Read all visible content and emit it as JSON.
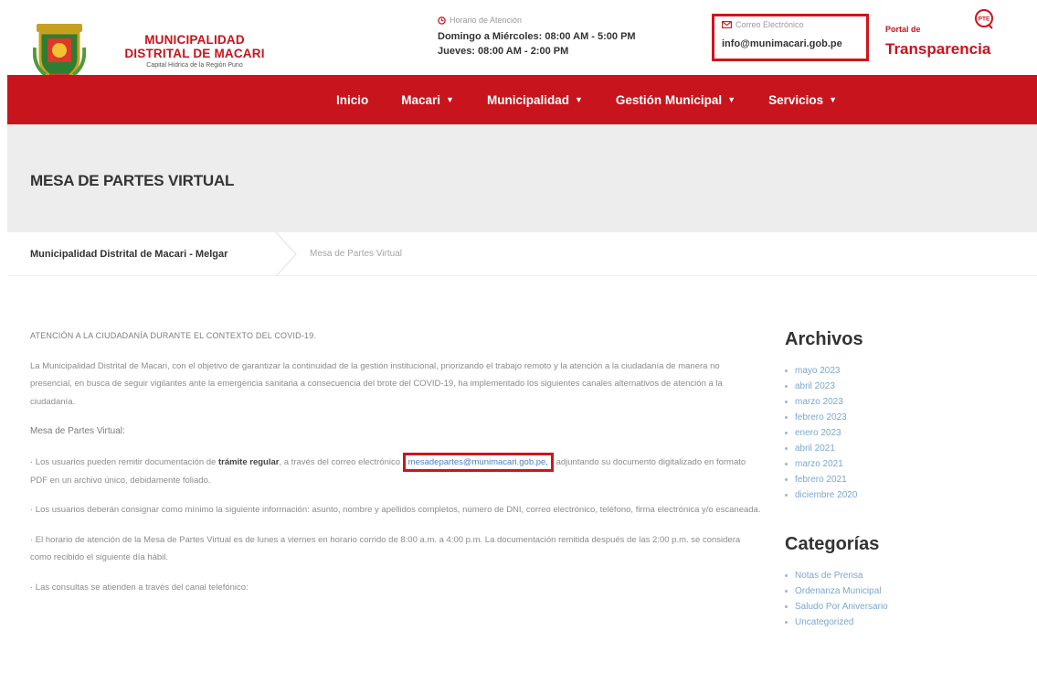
{
  "header": {
    "logo_title_line1": "MUNICIPALIDAD",
    "logo_title_line2": "DISTRITAL DE MACARI",
    "logo_subtitle": "Capital Hídrica de la Región Puno",
    "hours_label": "Horario de Atención",
    "hours_line1": "Domingo a Miércoles: 08:00 AM - 5:00 PM",
    "hours_line2": "Jueves: 08:00 AM - 2:00 PM",
    "email_label": "Correo Electrónico",
    "email_value": "info@munimacari.gob.pe",
    "portal_small": "Portal de",
    "portal_big": "Transparencia",
    "pte_badge": "PTE"
  },
  "nav": {
    "items": [
      {
        "label": "Inicio",
        "dropdown": false
      },
      {
        "label": "Macari",
        "dropdown": true
      },
      {
        "label": "Municipalidad",
        "dropdown": true
      },
      {
        "label": "Gestión Municipal",
        "dropdown": true
      },
      {
        "label": "Servicios",
        "dropdown": true
      }
    ]
  },
  "page": {
    "title": "MESA DE PARTES VIRTUAL",
    "breadcrumb_home": "Municipalidad Distrital de Macari - Melgar",
    "breadcrumb_current": "Mesa de Partes Virtual"
  },
  "content": {
    "headline": "ATENCIÓN A LA CIUDADANÍA DURANTE EL CONTEXTO DEL COVID-19.",
    "intro": "La Municipalidad Distrital de Macari, con el objetivo de garantizar la continuidad de la gestión institucional, priorizando el trabajo remoto y la atención a la ciudadanía de manera no presencial, en busca de seguir vigilantes ante la emergencia sanitaria a consecuencia del brote del COVID-19, ha implementado los siguientes canales alternativos de atención a la ciudadanía.",
    "section_title": "Mesa de Partes Virtual:",
    "p1_before": "· Los usuarios pueden remitir documentación de ",
    "p1_bold": "trámite regular",
    "p1_middle": ", a través del correo electrónico ",
    "p1_email": "mesadepartes@munimacari.gob.pe,",
    "p1_after": " adjuntando su documento digitalizado en formato PDF en un archivo único, debidamente foliado.",
    "p2": "· Los usuarios deberán consignar como mínimo la siguiente información: asunto, nombre y apellidos completos, número de DNI, correo electrónico, teléfono, firma electrónica y/o escaneada.",
    "p3": "· El horario de atención de la Mesa de Partes Virtual es de lunes a viernes en horario corrido de 8:00 a.m. a 4:00 p.m. La documentación remitida después de las 2:00 p.m. se considera como recibido el siguiente día hábil.",
    "p4": "· Las consultas se atienden a través del canal telefónico:"
  },
  "sidebar": {
    "archives_title": "Archivos",
    "archives": [
      "mayo 2023",
      "abril 2023",
      "marzo 2023",
      "febrero 2023",
      "enero 2023",
      "abril 2021",
      "marzo 2021",
      "febrero 2021",
      "diciembre 2020"
    ],
    "categories_title": "Categorías",
    "categories": [
      "Notas de Prensa",
      "Ordenanza Municipal",
      "Saludo Por Aniversario",
      "Uncategorized"
    ]
  },
  "colors": {
    "brand_red": "#c8141c",
    "link_blue": "#4a7fbf",
    "hero_gray": "#ededed"
  }
}
